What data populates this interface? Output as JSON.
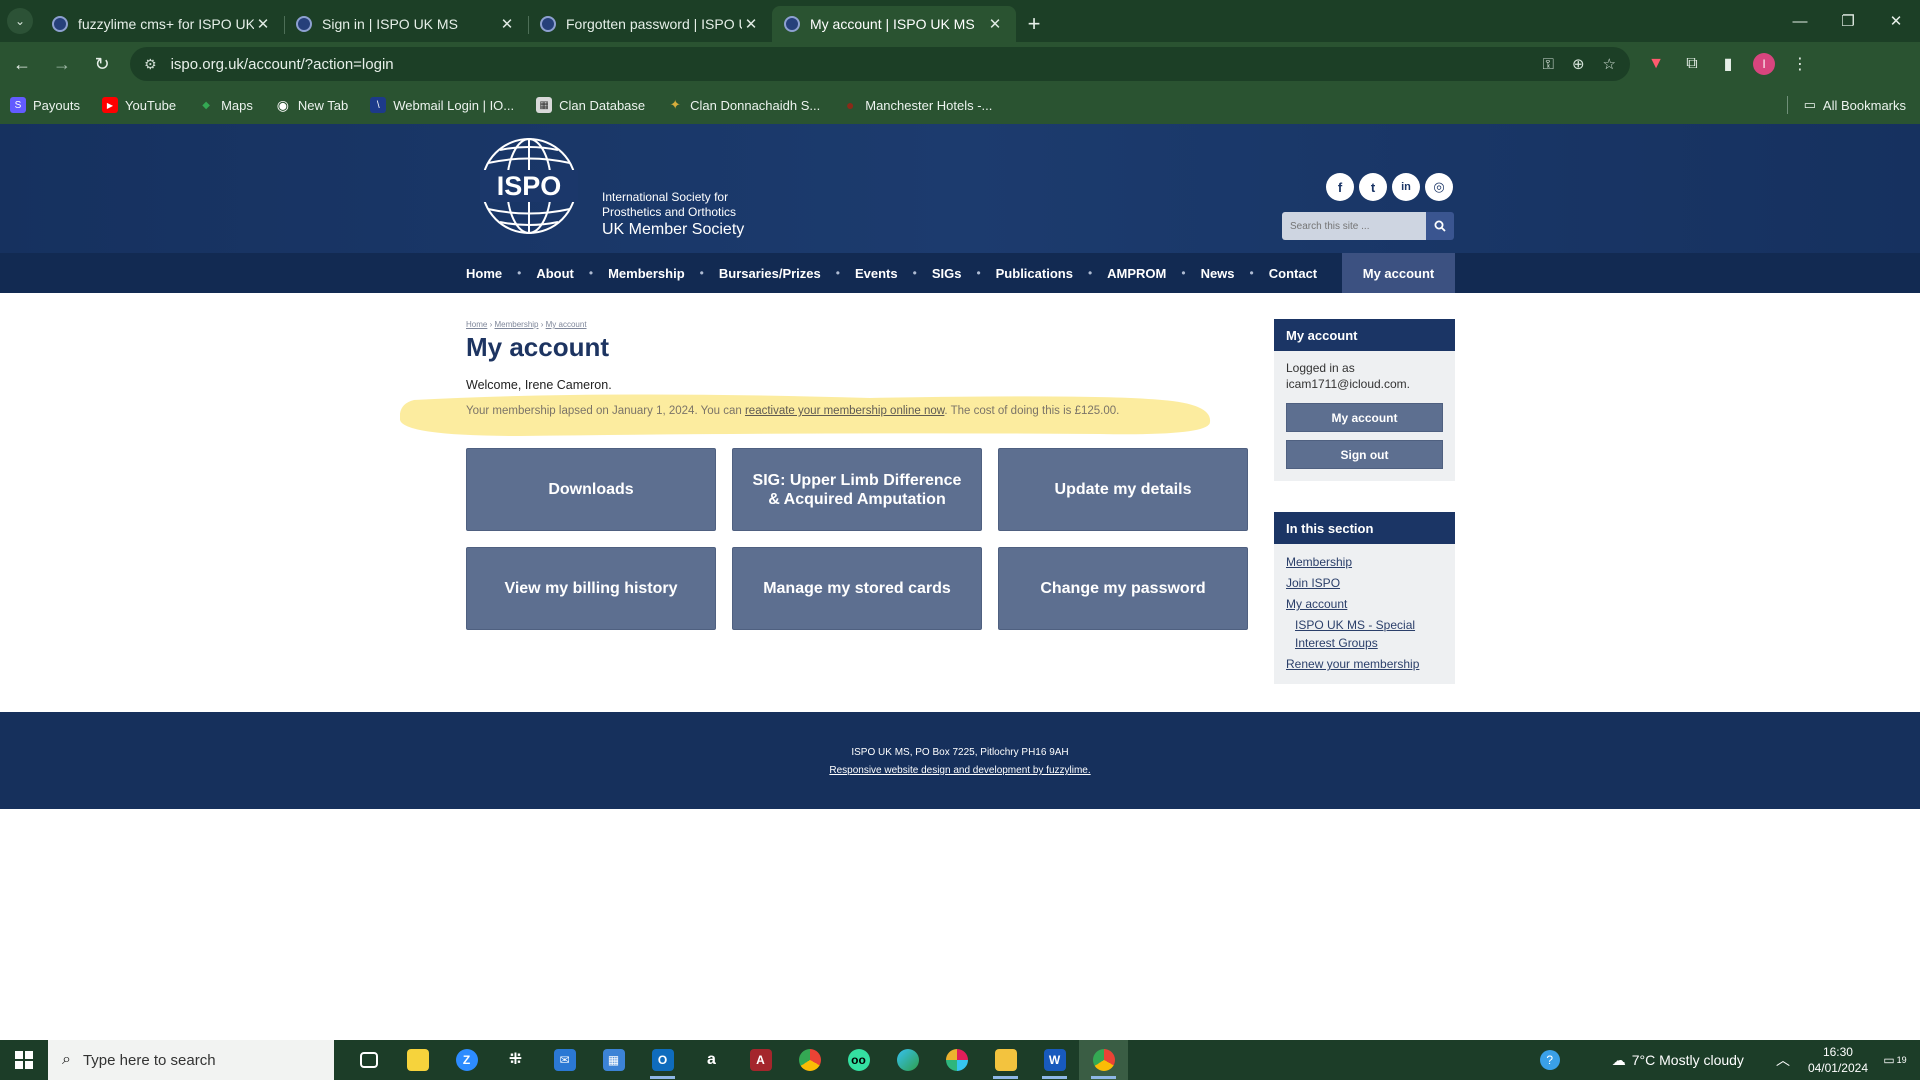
{
  "browser": {
    "tabs": [
      {
        "title": "fuzzylime cms+ for ISPO UK MS",
        "close": "✕"
      },
      {
        "title": "Sign in | ISPO UK MS",
        "close": "✕"
      },
      {
        "title": "Forgotten password | ISPO UK MS",
        "close": "✕"
      },
      {
        "title": "My account | ISPO UK MS",
        "close": "✕"
      }
    ],
    "active_tab": 3,
    "new_tab": "+",
    "url": "ispo.org.uk/account/?action=login",
    "bookmarks": [
      {
        "label": "Payouts",
        "icon": "S",
        "color": "#635bff"
      },
      {
        "label": "YouTube",
        "icon": "▶",
        "color": "#ff0000"
      },
      {
        "label": "Maps",
        "icon": "◆",
        "color": "#34a853"
      },
      {
        "label": "New Tab",
        "icon": "◉",
        "color": "#2a5331"
      },
      {
        "label": "Webmail Login | IO...",
        "icon": "\\",
        "color": "#1d3a8a"
      },
      {
        "label": "Clan Database",
        "icon": "▦",
        "color": "#c9c9c9"
      },
      {
        "label": "Clan Donnachaidh S...",
        "icon": "✦",
        "color": "#b08a2a"
      },
      {
        "label": "Manchester Hotels -...",
        "icon": "●",
        "color": "#6b1d12"
      }
    ],
    "all_bookmarks": "All Bookmarks"
  },
  "site": {
    "logo_text": "ISPO",
    "tagline_line1": "International Society for",
    "tagline_line2": "Prosthetics and Orthotics",
    "tagline_line3": "UK Member Society",
    "social": [
      "f",
      "t",
      "in",
      "◎"
    ],
    "search_placeholder": "Search this site ...",
    "nav": [
      "Home",
      "About",
      "Membership",
      "Bursaries/Prizes",
      "Events",
      "SIGs",
      "Publications",
      "AMPROM",
      "News",
      "Contact"
    ],
    "nav_account": "My account",
    "breadcrumb": [
      "Home",
      "Membership",
      "My account"
    ],
    "breadcrumb_sep": "›",
    "title": "My account",
    "welcome": "Welcome, Irene Cameron.",
    "lapse_before": "Your membership lapsed on January 1, 2024. You can ",
    "lapse_link": "reactivate your membership online now",
    "lapse_after": ". The cost of doing this is £125.00.",
    "tiles": [
      "Downloads",
      "SIG: Upper Limb Difference & Acquired Amputation",
      "Update my details",
      "View my billing history",
      "Manage my stored cards",
      "Change my password"
    ],
    "account_panel": {
      "title": "My account",
      "logged_in_as": "Logged in as",
      "email": "icam1711@icloud.com.",
      "btn_account": "My account",
      "btn_signout": "Sign out"
    },
    "section_panel": {
      "title": "In this section",
      "links": [
        "Membership",
        "Join ISPO",
        "My account",
        "ISPO UK MS - Special Interest Groups",
        "Renew your membership"
      ]
    },
    "footer_address": "ISPO UK MS, PO Box 7225, Pitlochry PH16 9AH",
    "footer_credit": "Responsive website design and development by fuzzylime."
  },
  "taskbar": {
    "search_placeholder": "Type here to search",
    "weather": "7°C  Mostly cloudy",
    "time": "16:30",
    "date": "04/01/2024",
    "notification_count": "19"
  }
}
